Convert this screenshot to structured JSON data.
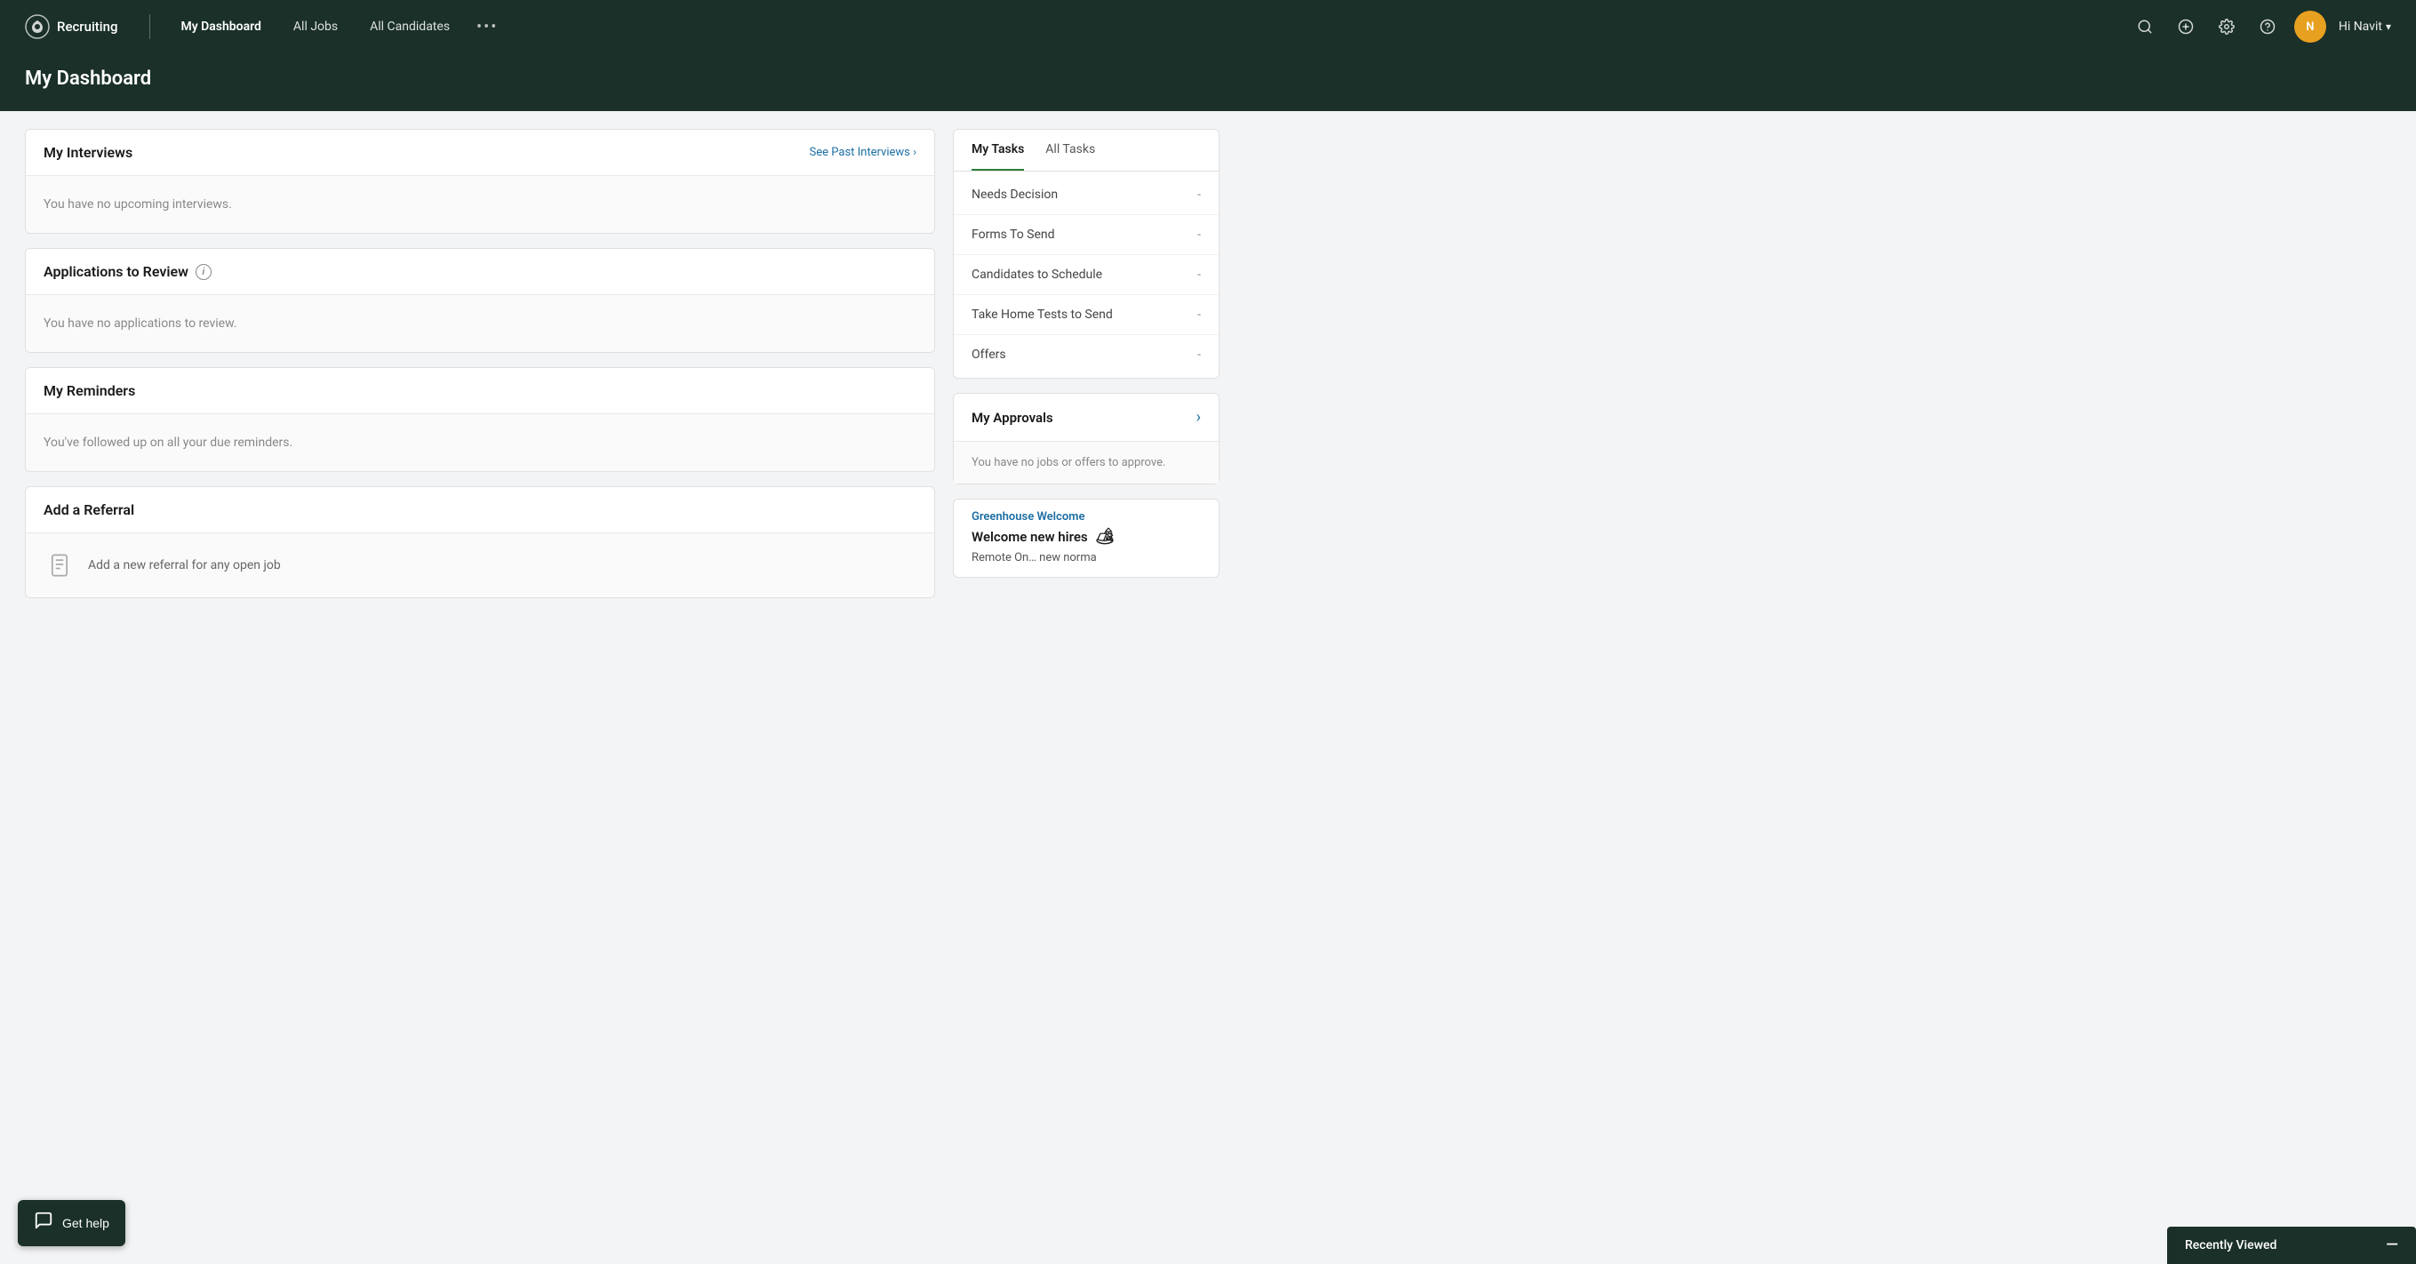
{
  "app": {
    "name": "Recruiting",
    "logo_symbol": "♾"
  },
  "topnav": {
    "links": [
      {
        "label": "My Dashboard",
        "active": true
      },
      {
        "label": "All Jobs",
        "active": false
      },
      {
        "label": "All Candidates",
        "active": false
      }
    ],
    "more_label": "•••",
    "user_greeting": "Hi Navit",
    "user_chevron": "▾"
  },
  "page_header": {
    "title": "My Dashboard"
  },
  "interviews_section": {
    "heading": "My Interviews",
    "see_past_link": "See Past Interviews ›",
    "empty_message": "You have no upcoming interviews."
  },
  "applications_section": {
    "heading": "Applications to Review",
    "empty_message": "You have no applications to review."
  },
  "reminders_section": {
    "heading": "My Reminders",
    "empty_message": "You've followed up on all your due reminders."
  },
  "referral_section": {
    "heading": "Add a Referral",
    "body_text": "Add a new referral for any open job"
  },
  "tasks": {
    "tab_my": "My Tasks",
    "tab_all": "All Tasks",
    "items": [
      {
        "label": "Needs Decision",
        "value": "-"
      },
      {
        "label": "Forms To Send",
        "value": "-"
      },
      {
        "label": "Candidates to Schedule",
        "value": "-"
      },
      {
        "label": "Take Home Tests to Send",
        "value": "-"
      },
      {
        "label": "Offers",
        "value": "-"
      }
    ]
  },
  "approvals": {
    "heading": "My Approvals",
    "empty_message": "You have no jobs or offers to approve."
  },
  "welcome": {
    "link_text": "Greenhouse Welcome",
    "title": "Welcome new hires",
    "body_text": "Remote On… new norma",
    "emoji": "🏕"
  },
  "recently_viewed": {
    "label": "Recently Viewed",
    "close_symbol": "—"
  },
  "get_help": {
    "label": "Get help"
  }
}
